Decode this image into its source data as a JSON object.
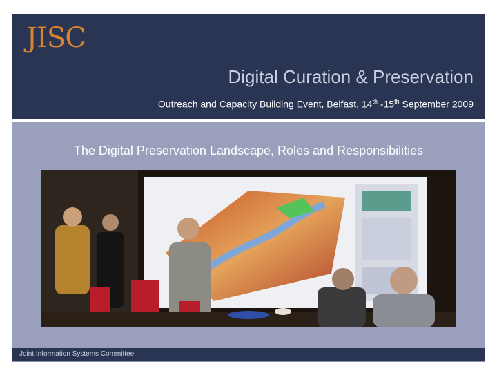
{
  "header": {
    "logo_text": "JISC",
    "title": "Digital Curation & Preservation",
    "subtitle_pre": "Outreach and Capacity Building Event, Belfast, 14",
    "sup1": "th",
    "subtitle_mid": " -15",
    "sup2": "th",
    "subtitle_post": " September 2009"
  },
  "main": {
    "heading": "The Digital Preservation Landscape, Roles and Responsibilities"
  },
  "footer": {
    "text": "Joint Information Systems Committee"
  },
  "colors": {
    "navy": "#2a3553",
    "logo_orange": "#d8842e",
    "panel": "#9aa0bc"
  }
}
